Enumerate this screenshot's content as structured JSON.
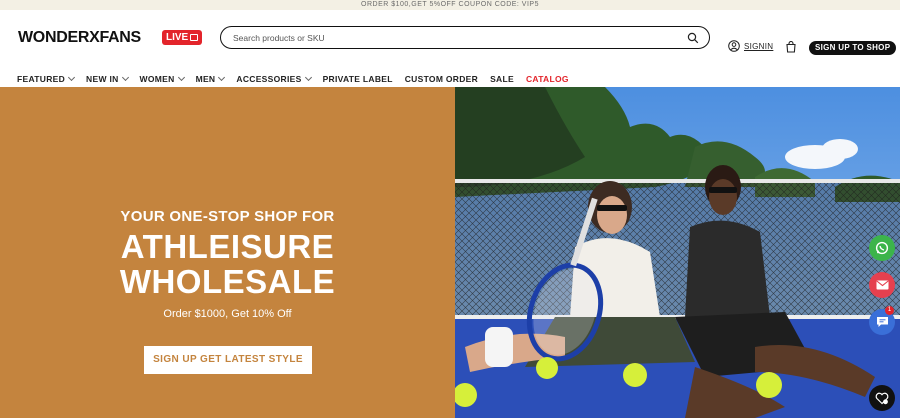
{
  "promo": {
    "text": "ORDER $100,GET 5%OFF  COUPON CODE: VIP5"
  },
  "header": {
    "logo": "WONDERXFANS",
    "live_label": "LIVE",
    "search_placeholder": "Search products or SKU",
    "signin_label": "SIGNIN",
    "signup_label": "SIGN UP TO SHOP"
  },
  "nav": {
    "items": [
      {
        "label": "FEATURED"
      },
      {
        "label": "NEW IN"
      },
      {
        "label": "WOMEN"
      },
      {
        "label": "MEN"
      },
      {
        "label": "ACCESSORIES"
      },
      {
        "label": "PRIVATE LABEL"
      },
      {
        "label": "CUSTOM ORDER"
      },
      {
        "label": "SALE"
      },
      {
        "label": "CATALOG"
      }
    ]
  },
  "hero": {
    "subtitle": "YOUR ONE-STOP SHOP FOR",
    "title_line1": "ATHLEISURE",
    "title_line2": "WHOLESALE",
    "offer": "Order $1000, Get 10% Off",
    "button": "SIGN UP GET LATEST STYLE"
  },
  "floating": {
    "chat_badge": "1"
  },
  "colors": {
    "hero_bg": "#c4843e",
    "accent_red": "#e3242b",
    "whatsapp": "#3cb44a",
    "mail": "#e5404f",
    "chat": "#3a6fd8"
  }
}
